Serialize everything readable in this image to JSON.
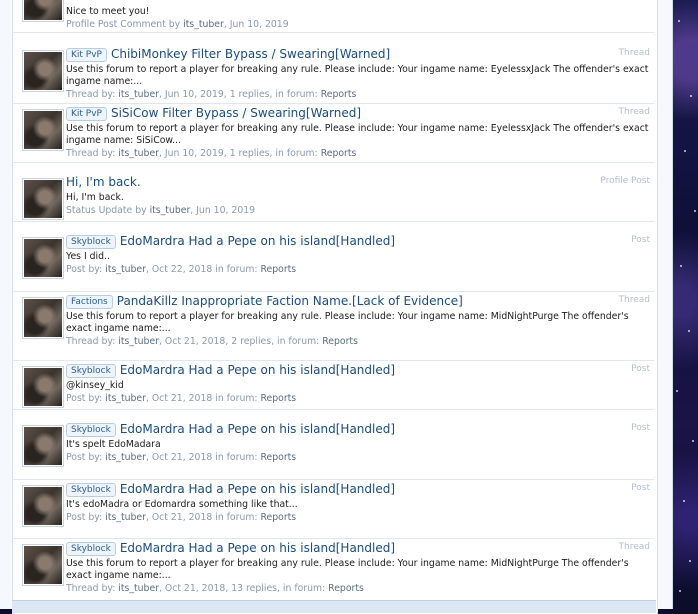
{
  "results": [
    {
      "kind": "comment",
      "title": "",
      "prefix": "",
      "snippet": "Nice to meet you!",
      "meta_type": "Profile Post Comment by ",
      "user": "its_tuber",
      "date": ", Jun 10, 2019",
      "replies": "",
      "forum": "",
      "content_type": ""
    },
    {
      "kind": "thread",
      "prefix": "Kit PvP",
      "title": "ChibiMonkey Filter Bypass / Swearing[Warned]",
      "snippet": "Use this forum to report a player for breaking any rule. Please include: Your ingame name: EyelessxJack The offender's exact ingame name:...",
      "meta_type": "Thread by: ",
      "user": "its_tuber",
      "date": ", Jun 10, 2019, ",
      "replies": "1 replies, in forum: ",
      "forum": "Reports",
      "content_type": "Thread"
    },
    {
      "kind": "thread",
      "prefix": "Kit PvP",
      "title": "SiSiCow Filter Bypass / Swearing[Warned]",
      "snippet": "Use this forum to report a player for breaking any rule. Please include: Your ingame name: EyelessxJack The offender's exact ingame name: SiSiCow...",
      "meta_type": "Thread by: ",
      "user": "its_tuber",
      "date": ", Jun 10, 2019, ",
      "replies": "1 replies, in forum: ",
      "forum": "Reports",
      "content_type": "Thread"
    },
    {
      "kind": "status",
      "prefix": "",
      "title": "Hi, I'm back.",
      "snippet": "Hi, I'm back.",
      "meta_type": "Status Update by ",
      "user": "its_tuber",
      "date": ", Jun 10, 2019",
      "replies": "",
      "forum": "",
      "content_type": "Profile Post"
    },
    {
      "kind": "post",
      "prefix": "Skyblock",
      "title": "EdoMardra Had a Pepe on his island[Handled]",
      "snippet": "Yes I did..",
      "meta_type": "Post by: ",
      "user": "its_tuber",
      "date": ", Oct 22, 2018 in forum: ",
      "replies": "",
      "forum": "Reports",
      "content_type": "Post"
    },
    {
      "kind": "thread",
      "prefix": "Factions",
      "title": "PandaKillz Inappropriate Faction Name.[Lack of Evidence]",
      "snippet": "Use this forum to report a player for breaking any rule. Please include: Your ingame name: MidNightPurge The offender's exact ingame name:...",
      "meta_type": "Thread by: ",
      "user": "its_tuber",
      "date": ", Oct 21, 2018, ",
      "replies": "2 replies, in forum: ",
      "forum": "Reports",
      "content_type": "Thread"
    },
    {
      "kind": "post",
      "prefix": "Skyblock",
      "title": "EdoMardra Had a Pepe on his island[Handled]",
      "snippet": "@kinsey_kid",
      "meta_type": "Post by: ",
      "user": "its_tuber",
      "date": ", Oct 21, 2018 in forum: ",
      "replies": "",
      "forum": "Reports",
      "content_type": "Post"
    },
    {
      "kind": "post",
      "prefix": "Skyblock",
      "title": "EdoMardra Had a Pepe on his island[Handled]",
      "snippet": "It's spelt EdoMadara",
      "meta_type": "Post by: ",
      "user": "its_tuber",
      "date": ", Oct 21, 2018 in forum: ",
      "replies": "",
      "forum": "Reports",
      "content_type": "Post"
    },
    {
      "kind": "post",
      "prefix": "Skyblock",
      "title": "EdoMardra Had a Pepe on his island[Handled]",
      "snippet": "It's edoMadra or Edomardra something like that...",
      "meta_type": "Post by: ",
      "user": "its_tuber",
      "date": ", Oct 21, 2018 in forum: ",
      "replies": "",
      "forum": "Reports",
      "content_type": "Post"
    },
    {
      "kind": "thread",
      "prefix": "Skyblock",
      "title": "EdoMardra Had a Pepe on his island[Handled]",
      "snippet": "Use this forum to report a player for breaking any rule. Please include: Your ingame name: MidNightPurge The offender's exact ingame name:...",
      "meta_type": "Thread by: ",
      "user": "its_tuber",
      "date": ", Oct 21, 2018, ",
      "replies": "13 replies, in forum: ",
      "forum": "Reports",
      "content_type": "Thread"
    }
  ],
  "colors": {
    "link": "#1a4c7d",
    "meta": "#8a9aaa",
    "background": "#0b0d2a"
  }
}
